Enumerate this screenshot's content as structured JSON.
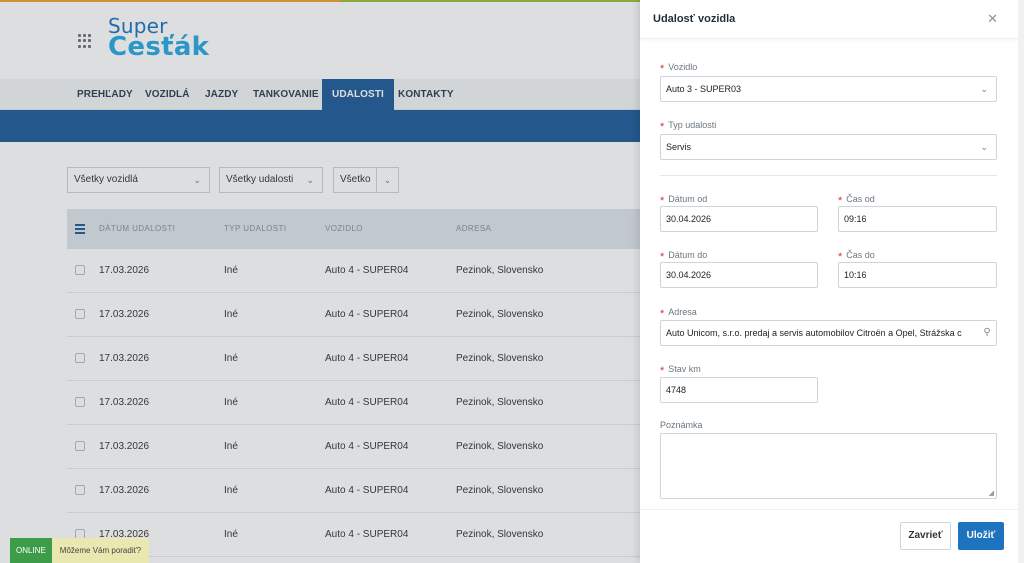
{
  "colors": {
    "brand_blue": "#1f5c99",
    "accent_blue": "#1e73be",
    "logo_light": "#29a8e0",
    "required_red": "#d9342b",
    "online_green": "#3c9c4a",
    "top_stripe": [
      "#f0a32b",
      "#9bbf3c",
      "#3aaed8"
    ]
  },
  "app": {
    "logo_line1": "Super",
    "logo_line2": "Cesťák",
    "apps_icon": "grid-icon"
  },
  "nav": {
    "items": [
      {
        "label": "PREHĽADY"
      },
      {
        "label": "VOZIDLÁ"
      },
      {
        "label": "JAZDY"
      },
      {
        "label": "TANKOVANIE"
      },
      {
        "label": "UDALOSTI",
        "active": true
      },
      {
        "label": "KONTAKTY"
      }
    ]
  },
  "filters": {
    "vehicles": "Všetky vozidlá",
    "events": "Všetky udalosti",
    "all": "Všetko"
  },
  "table": {
    "columns": [
      "DÁTUM UDALOSTI",
      "TYP UDALOSTI",
      "VOZIDLO",
      "ADRESA"
    ],
    "rows": [
      {
        "date": "17.03.2026",
        "type": "Iné",
        "vehicle": "Auto 4 - SUPER04",
        "address": "Pezinok, Slovensko"
      },
      {
        "date": "17.03.2026",
        "type": "Iné",
        "vehicle": "Auto 4 - SUPER04",
        "address": "Pezinok, Slovensko"
      },
      {
        "date": "17.03.2026",
        "type": "Iné",
        "vehicle": "Auto 4 - SUPER04",
        "address": "Pezinok, Slovensko"
      },
      {
        "date": "17.03.2026",
        "type": "Iné",
        "vehicle": "Auto 4 - SUPER04",
        "address": "Pezinok, Slovensko"
      },
      {
        "date": "17.03.2026",
        "type": "Iné",
        "vehicle": "Auto 4 - SUPER04",
        "address": "Pezinok, Slovensko"
      },
      {
        "date": "17.03.2026",
        "type": "Iné",
        "vehicle": "Auto 4 - SUPER04",
        "address": "Pezinok, Slovensko"
      },
      {
        "date": "17.03.2026",
        "type": "Iné",
        "vehicle": "Auto 4 - SUPER04",
        "address": "Pezinok, Slovensko"
      }
    ]
  },
  "chat": {
    "status": "ONLINE",
    "message": "Môžeme Vám poradiť?"
  },
  "panel": {
    "title": "Udalosť vozidla",
    "required_mark": "*",
    "vehicle": {
      "label": "Vozidlo",
      "value": "Auto 3 - SUPER03"
    },
    "event_type": {
      "label": "Typ udalosti",
      "value": "Servis"
    },
    "date_from": {
      "label": "Dátum od",
      "value": "30.04.2026"
    },
    "time_from": {
      "label": "Čas od",
      "value": "09:16"
    },
    "date_to": {
      "label": "Dátum do",
      "value": "30.04.2026"
    },
    "time_to": {
      "label": "Čas do",
      "value": "10:16"
    },
    "address": {
      "label": "Adresa",
      "value": "Auto Unicom, s.r.o. predaj a servis automobilov Citroën a Opel, Strážska c"
    },
    "odometer": {
      "label": "Stav km",
      "value": "4748"
    },
    "note": {
      "label": "Poznámka",
      "value": ""
    },
    "close_label": "Zavrieť",
    "save_label": "Uložiť"
  }
}
